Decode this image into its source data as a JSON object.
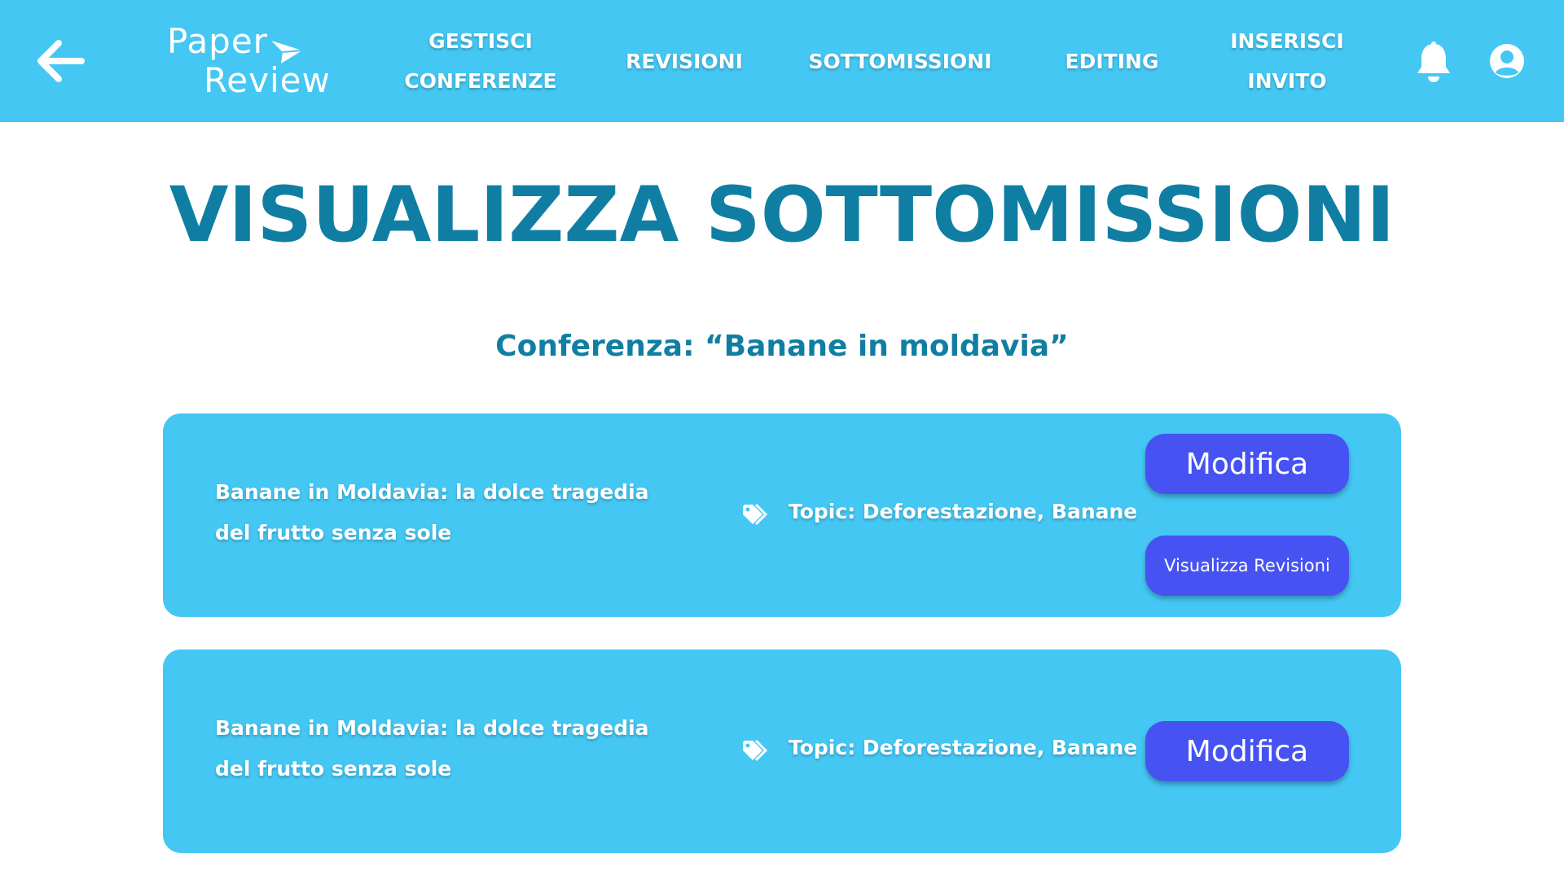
{
  "nav": {
    "logo_line1": "Paper",
    "logo_line2": "Review",
    "items": [
      {
        "line1": "GESTISCI",
        "line2": "CONFERENZE"
      },
      {
        "line1": "REVISIONI",
        "line2": ""
      },
      {
        "line1": "SOTTOMISSIONI",
        "line2": ""
      },
      {
        "line1": "EDITING",
        "line2": ""
      },
      {
        "line1": "INSERISCI",
        "line2": "INVITO"
      }
    ],
    "icons": [
      "back-arrow-icon",
      "bell-icon",
      "user-icon"
    ]
  },
  "page": {
    "title": "VISUALIZZA SOTTOMISSIONI",
    "subtitle": "Conferenza: “Banane in moldavia”"
  },
  "submissions": [
    {
      "title": "Banane in Moldavia: la dolce tragedia del frutto senza sole",
      "topic": "Topic: Deforestazione, Banane",
      "edit_label": "Modifica",
      "reviews_label": "Visualizza Revisioni"
    },
    {
      "title": "Banane in Moldavia: la dolce tragedia del frutto senza sole",
      "topic": "Topic: Deforestazione, Banane",
      "edit_label": "Modifica"
    }
  ],
  "colors": {
    "header": "#44c7f3",
    "card": "#44c7f3",
    "title": "#107ea3",
    "button": "#4653f2",
    "text_light": "#ffffff"
  }
}
